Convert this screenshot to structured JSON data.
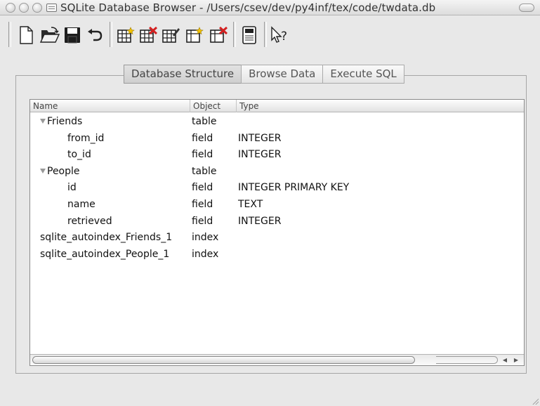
{
  "window": {
    "title": "SQLite Database Browser - /Users/csev/dev/py4inf/tex/code/twdata.db"
  },
  "toolbar": {
    "buttons": [
      {
        "name": "new-database",
        "icon": "new-document-icon"
      },
      {
        "name": "open-database",
        "icon": "open-folder-icon"
      },
      {
        "name": "save-database",
        "icon": "floppy-disk-icon"
      },
      {
        "name": "undo",
        "icon": "undo-arrow-icon"
      },
      {
        "name": "create-table",
        "icon": "table-add-icon"
      },
      {
        "name": "delete-table",
        "icon": "table-delete-icon"
      },
      {
        "name": "modify-table",
        "icon": "table-edit-icon"
      },
      {
        "name": "create-index",
        "icon": "index-add-icon"
      },
      {
        "name": "delete-index",
        "icon": "index-delete-icon"
      },
      {
        "name": "sql-log",
        "icon": "log-icon"
      },
      {
        "name": "whats-this",
        "icon": "whats-this-icon"
      }
    ]
  },
  "tabs": [
    {
      "label": "Database Structure",
      "active": true
    },
    {
      "label": "Browse Data",
      "active": false
    },
    {
      "label": "Execute SQL",
      "active": false
    }
  ],
  "tree": {
    "columns": [
      "Name",
      "Object",
      "Type"
    ],
    "rows": [
      {
        "name": "Friends",
        "object": "table",
        "type": "",
        "level": 0,
        "expandable": true
      },
      {
        "name": "from_id",
        "object": "field",
        "type": "INTEGER",
        "level": 1
      },
      {
        "name": "to_id",
        "object": "field",
        "type": "INTEGER",
        "level": 1
      },
      {
        "name": "People",
        "object": "table",
        "type": "",
        "level": 0,
        "expandable": true
      },
      {
        "name": "id",
        "object": "field",
        "type": "INTEGER PRIMARY KEY",
        "level": 1
      },
      {
        "name": "name",
        "object": "field",
        "type": "TEXT",
        "level": 1
      },
      {
        "name": "retrieved",
        "object": "field",
        "type": "INTEGER",
        "level": 1
      },
      {
        "name": "sqlite_autoindex_Friends_1",
        "object": "index",
        "type": "",
        "level": 0
      },
      {
        "name": "sqlite_autoindex_People_1",
        "object": "index",
        "type": "",
        "level": 0
      }
    ]
  },
  "colors": {
    "window_bg": "#e8e8e8",
    "tree_bg": "#ffffff",
    "table_icon_yellow": "#f2c200",
    "delete_red": "#d42020"
  }
}
